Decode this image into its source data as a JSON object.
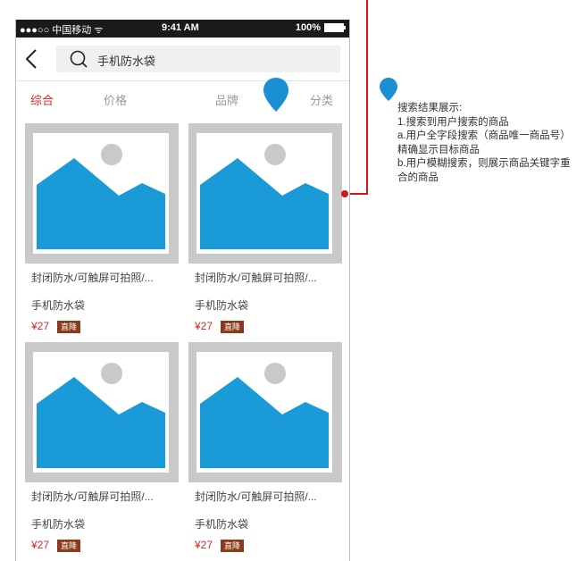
{
  "status_bar": {
    "carrier": "●●●○○ 中国移动 ᯤ",
    "time": "9:41 AM",
    "battery": "100%"
  },
  "search": {
    "query": "手机防水袋"
  },
  "filter_tabs": [
    "综合",
    "价格",
    "品牌",
    "分类"
  ],
  "products": [
    {
      "title": "封闭防水/可触屏可拍照/...",
      "subtitle": "手机防水袋",
      "price": "¥27",
      "tag": "直降"
    },
    {
      "title": "封闭防水/可触屏可拍照/...",
      "subtitle": "手机防水袋",
      "price": "¥27",
      "tag": "直降"
    },
    {
      "title": "封闭防水/可触屏可拍照/...",
      "subtitle": "手机防水袋",
      "price": "¥27",
      "tag": "直降"
    },
    {
      "title": "封闭防水/可触屏可拍照/...",
      "subtitle": "手机防水袋",
      "price": "¥27",
      "tag": "直降"
    }
  ],
  "markers": {
    "phone_marker": "6",
    "annotation_marker": "6"
  },
  "annotation": {
    "lines": [
      "搜索结果展示:",
      "1.搜索到用户搜索的商品",
      "a.用户全字段搜索（商品唯一商品号）精确显示目标商品",
      "b.用户模糊搜索，则展示商品关键字重合的商品"
    ]
  },
  "colors": {
    "accent_red": "#cc2b2b",
    "image_blue": "#1a9ad6",
    "tag_brown": "#8b3a1a",
    "marker_blue": "#1a8fd1",
    "connector_red": "#cc1a1a"
  }
}
